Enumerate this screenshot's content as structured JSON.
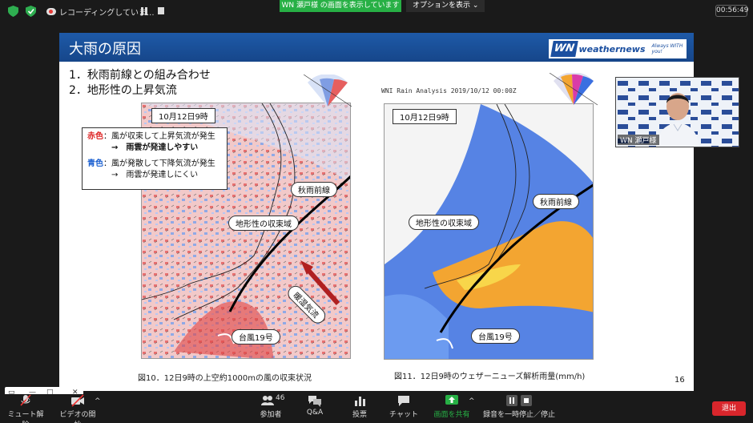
{
  "topbar": {
    "recording_label": "レコーディングしていま...",
    "share_banner": "WN 瀬戸様 の画面を表示しています",
    "share_options": "オプションを表示",
    "timer": "00:56:49"
  },
  "slide": {
    "title": "大雨の原因",
    "logo_mark": "WN",
    "logo_name": "weathernews",
    "logo_tagline": "Always WITH you!",
    "list": [
      "1．秋雨前線との組み合わせ",
      "2．地形性の上昇気流"
    ],
    "wni_header": "WNI Rain Analysis  2019/10/12 00:00Z",
    "map1": {
      "date": "10月12日9時",
      "front_label": "秋雨前線",
      "convergence_label": "地形性の収束域",
      "warm_label": "暖湿気流",
      "typhoon_label": "台風19号"
    },
    "map2": {
      "date": "10月12日9時",
      "front_label": "秋雨前線",
      "convergence_label": "地形性の収束域",
      "typhoon_label": "台風19号"
    },
    "legend": {
      "red_key": "赤色",
      "red_text": "：風が収束して上昇気流が発生",
      "red_result": "→　雨雲が発達しやすい",
      "blue_key": "青色",
      "blue_text": "：風が発散して下降気流が発生",
      "blue_result": "→　雨雲が発達しにくい"
    },
    "caption1": "図10．12日9時の上空約1000mの風の収束状況",
    "caption2": "図11．12日9時のウェザーニューズ解析雨量(mm/h)",
    "page_number": "16"
  },
  "speaker": {
    "name": "WN 瀬戸様"
  },
  "toolbar": {
    "mute": "ミュート解除",
    "video": "ビデオの開始",
    "participants": "参加者",
    "participant_count": "46",
    "qa": "Q&A",
    "poll": "投票",
    "chat": "チャット",
    "share": "画面を共有",
    "pause_recording": "録音を一時停止／停止",
    "end": "退出"
  },
  "colors": {
    "header_blue": "#1e5aa8",
    "share_green": "#27b045",
    "end_red": "#d9262c"
  }
}
